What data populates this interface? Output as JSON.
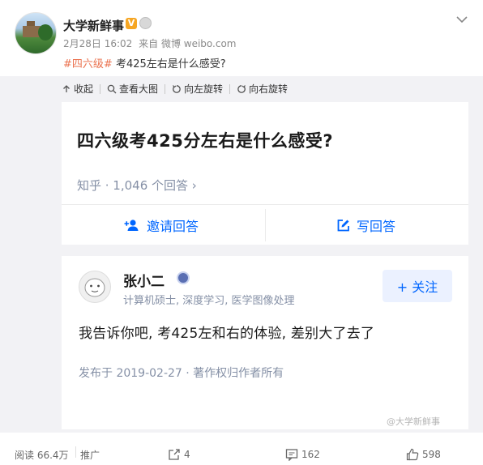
{
  "post": {
    "username": "大学新鲜事",
    "verified_badge": "V",
    "date": "2月28日 16:02",
    "source": "来自 微博 weibo.com",
    "hashtag": "#四六级#",
    "text": "考425左右是什么感受?"
  },
  "toolbar": {
    "collapse": "收起",
    "view_large": "查看大图",
    "rotate_left": "向左旋转",
    "rotate_right": "向右旋转"
  },
  "question": {
    "title": "四六级考425分左右是什么感受?",
    "meta": "知乎 · 1,046 个回答 ›",
    "invite": "邀请回答",
    "write": "写回答"
  },
  "answer": {
    "author": "张小二",
    "description": "计算机硕士, 深度学习, 医学图像处理",
    "follow": "+ 关注",
    "body": "我告诉你吧, 考425左和右的体验, 差别大了去了",
    "date": "发布于 2019-02-27 · 著作权归作者所有",
    "watermark": "@大学新鲜事"
  },
  "footer": {
    "reads": "阅读 66.4万",
    "promote": "推广",
    "reposts": "4",
    "comments": "162",
    "likes": "598"
  },
  "icons": {
    "chevron": "chevron-down-icon",
    "collapse": "collapse-arrow-icon",
    "search": "search-icon",
    "rotate_left": "rotate-left-icon",
    "rotate_right": "rotate-right-icon",
    "invite": "add-user-icon",
    "write": "edit-icon",
    "repost": "repost-icon",
    "comment": "comment-icon",
    "like": "thumbs-up-icon"
  },
  "colors": {
    "accent": "#0066ff",
    "hashtag": "#eb7350",
    "verified": "#f6a623"
  }
}
